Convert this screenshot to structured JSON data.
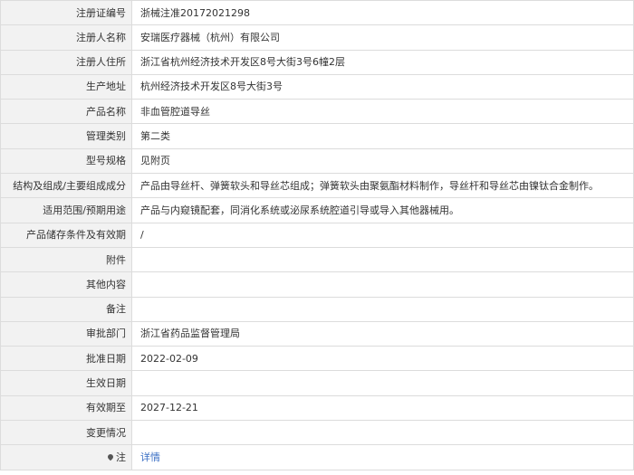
{
  "rows": [
    {
      "label": "注册证编号",
      "value": "浙械注准20172021298"
    },
    {
      "label": "注册人名称",
      "value": "安瑞医疗器械（杭州）有限公司"
    },
    {
      "label": "注册人住所",
      "value": "浙江省杭州经济技术开发区8号大街3号6幢2层"
    },
    {
      "label": "生产地址",
      "value": "杭州经济技术开发区8号大街3号"
    },
    {
      "label": "产品名称",
      "value": "非血管腔道导丝"
    },
    {
      "label": "管理类别",
      "value": "第二类"
    },
    {
      "label": "型号规格",
      "value": "见附页"
    },
    {
      "label": "结构及组成/主要组成成分",
      "value": "产品由导丝杆、弹簧软头和导丝芯组成；弹簧软头由聚氨酯材料制作，导丝杆和导丝芯由镍钛合金制作。"
    },
    {
      "label": "适用范围/预期用途",
      "value": "产品与内窥镜配套，同消化系统或泌尿系统腔道引导或导入其他器械用。"
    },
    {
      "label": "产品储存条件及有效期",
      "value": "/"
    },
    {
      "label": "附件",
      "value": ""
    },
    {
      "label": "其他内容",
      "value": ""
    },
    {
      "label": "备注",
      "value": ""
    },
    {
      "label": "审批部门",
      "value": "浙江省药品监督管理局"
    },
    {
      "label": "批准日期",
      "value": "2022-02-09"
    },
    {
      "label": "生效日期",
      "value": ""
    },
    {
      "label": "有效期至",
      "value": "2027-12-21"
    },
    {
      "label": "变更情况",
      "value": ""
    }
  ],
  "note": {
    "label": "注",
    "icon": "map-pin-icon",
    "link_text": "详情"
  }
}
